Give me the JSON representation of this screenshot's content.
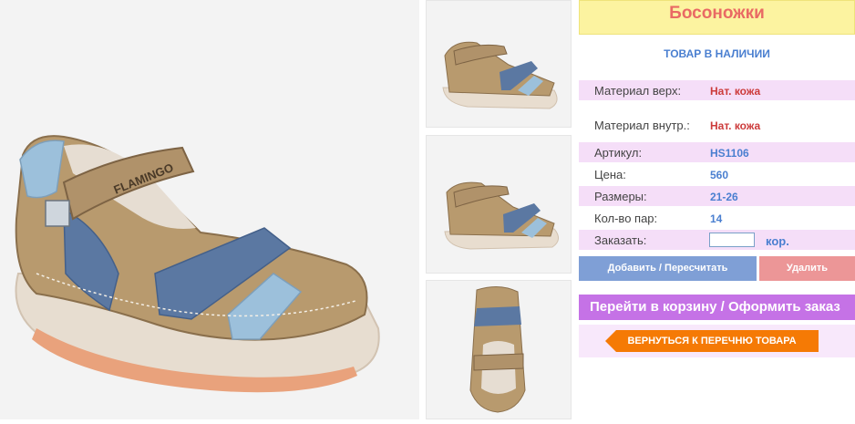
{
  "product": {
    "title": "Босоножки",
    "stock_status": "ТОВАР В НАЛИЧИИ",
    "brand_mark": "FLAMINGO"
  },
  "specs": [
    {
      "label": "Материал верх:",
      "value": "Нат. кожа"
    },
    {
      "label": "Материал внутр.:",
      "value": "Нат. кожа"
    },
    {
      "label": "Артикул:",
      "value": "HS1106"
    },
    {
      "label": "Цена:",
      "value": "560"
    },
    {
      "label": "Размеры:",
      "value": "21-26"
    },
    {
      "label": "Кол-во пар:",
      "value": "14"
    }
  ],
  "order": {
    "label": "Заказать:",
    "quantity_value": "",
    "unit": "кор."
  },
  "buttons": {
    "add_recalc": "Добавить / Пересчитать",
    "delete": "Удалить",
    "to_cart": "Перейти в корзину / Оформить заказ",
    "back_to_list": "ВЕРНУТЬСЯ К ПЕРЕЧНЮ ТОВАРА"
  },
  "colors": {
    "title_bg": "#fcf3a0",
    "title_text": "#e96a64",
    "accent_blue": "#4a7fd0",
    "value_red": "#cc3b3b",
    "row_pink": "#f5def8",
    "add_button": "#7f9fd6",
    "delete_button": "#ec9697",
    "cart_bar": "#c572e6",
    "back_button": "#f57a05"
  }
}
